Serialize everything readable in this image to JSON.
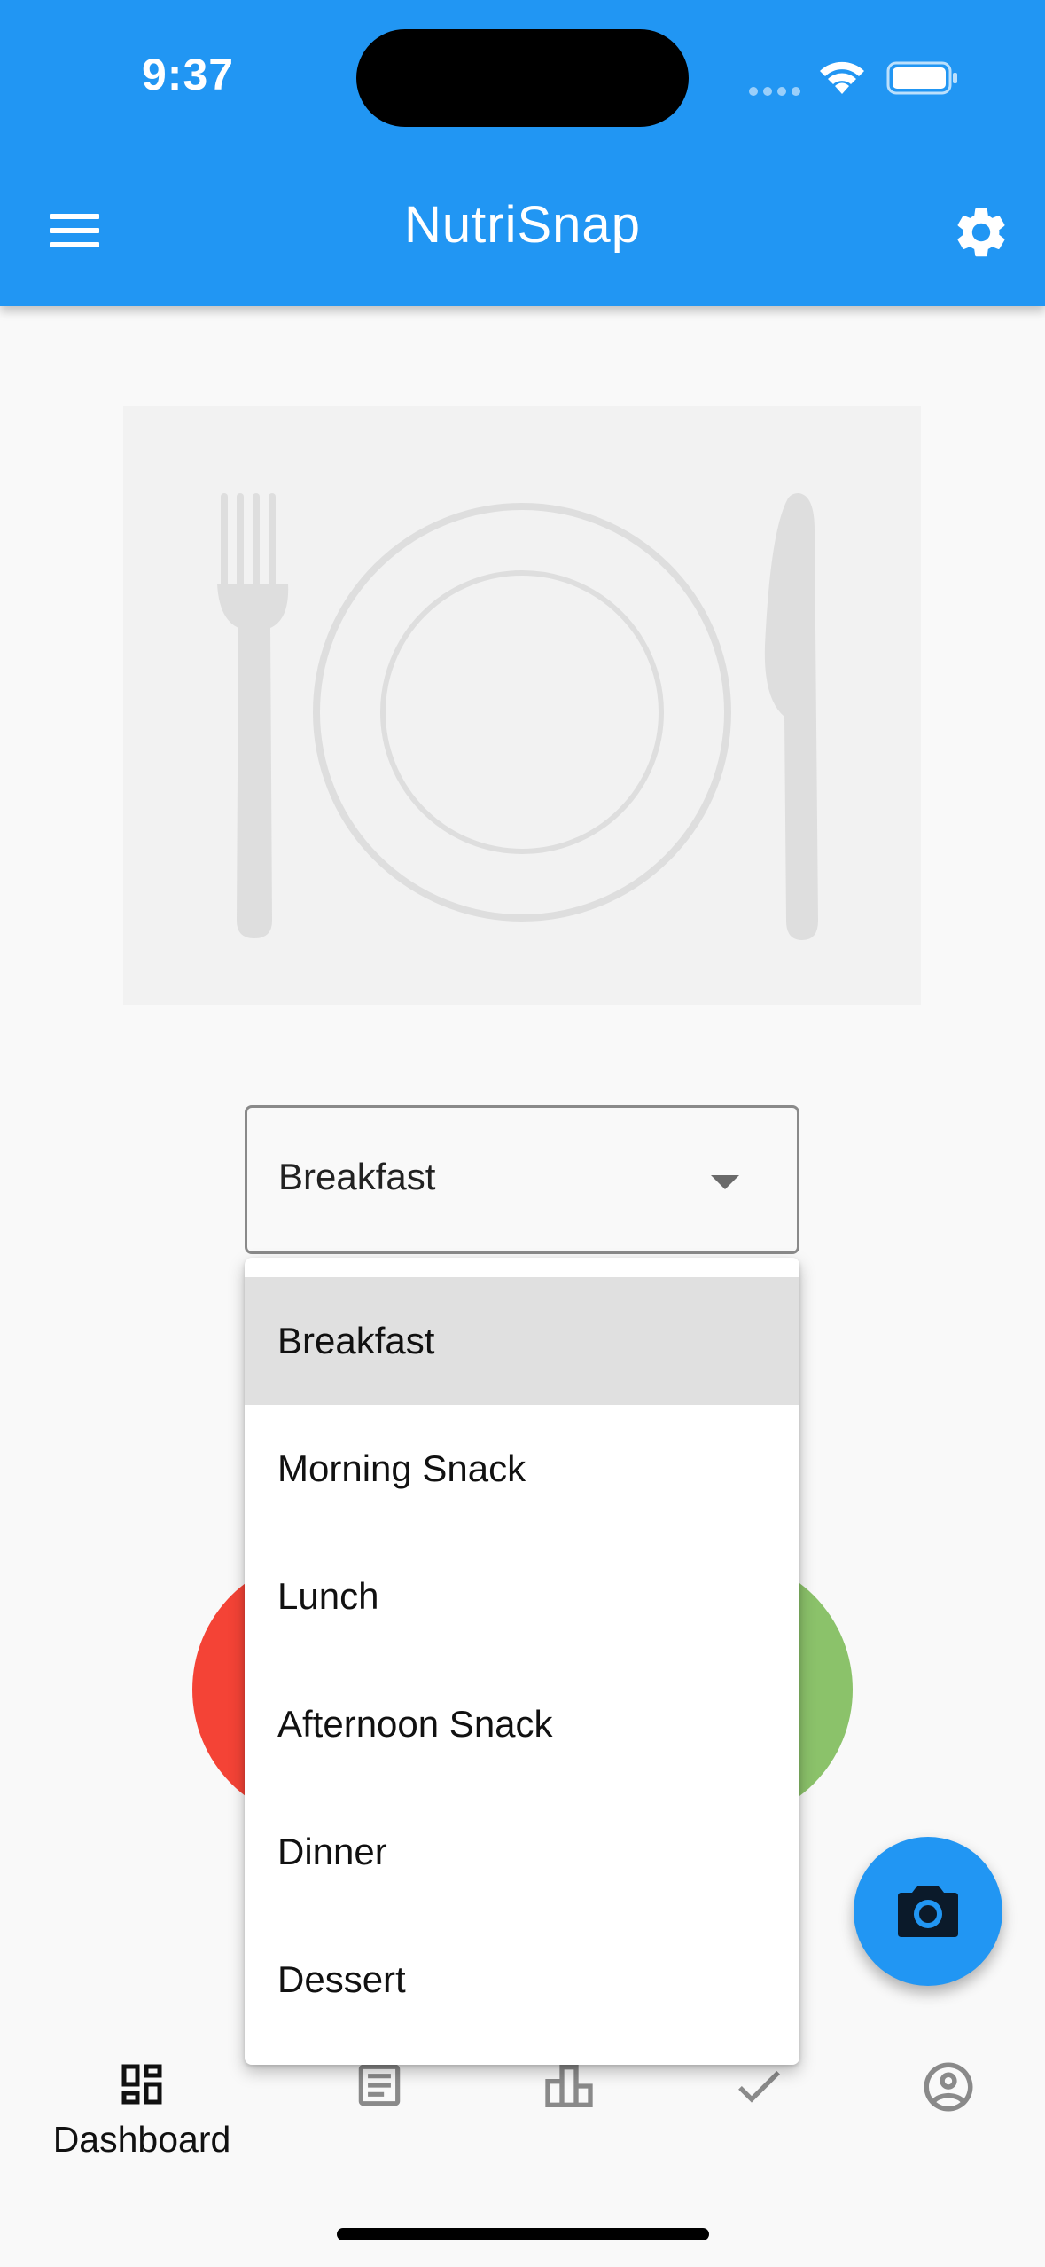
{
  "status_bar": {
    "time": "9:37"
  },
  "app_bar": {
    "title": "NutriSnap"
  },
  "meal_select": {
    "value": "Breakfast",
    "options": [
      "Breakfast",
      "Morning Snack",
      "Lunch",
      "Afternoon Snack",
      "Dinner",
      "Dessert"
    ]
  },
  "bottom_nav": {
    "items": [
      {
        "label": "Dashboard",
        "icon": "dashboard-icon",
        "active": true
      },
      {
        "label": "",
        "icon": "article-icon"
      },
      {
        "label": "",
        "icon": "leaderboard-icon"
      },
      {
        "label": "",
        "icon": "check-icon"
      },
      {
        "label": "",
        "icon": "account-circle-icon"
      }
    ]
  },
  "colors": {
    "primary": "#2196f3",
    "red": "#f44336",
    "green": "#8bc26a"
  }
}
